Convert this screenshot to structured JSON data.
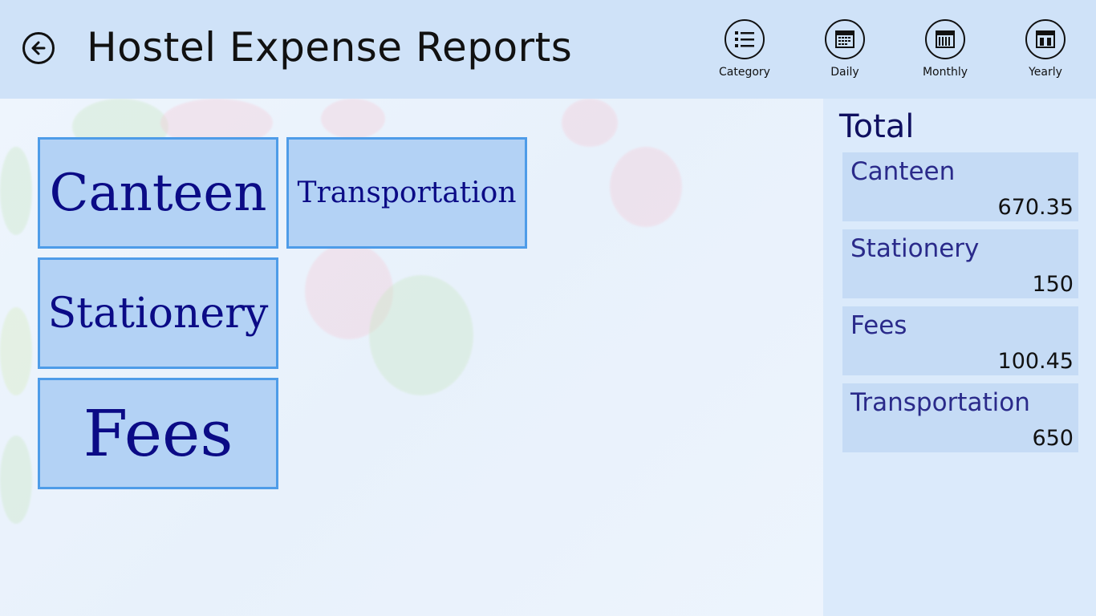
{
  "header": {
    "title": "Hostel Expense Reports",
    "back_icon": "back-arrow-icon"
  },
  "appbar": [
    {
      "label": "Category",
      "icon": "list-icon"
    },
    {
      "label": "Daily",
      "icon": "calendar-day-icon"
    },
    {
      "label": "Monthly",
      "icon": "calendar-month-icon"
    },
    {
      "label": "Yearly",
      "icon": "calendar-year-icon"
    }
  ],
  "tiles": [
    {
      "label": "Canteen"
    },
    {
      "label": "Transportation"
    },
    {
      "label": "Stationery"
    },
    {
      "label": "Fees"
    }
  ],
  "totals": {
    "title": "Total",
    "items": [
      {
        "name": "Canteen",
        "amount": "670.35"
      },
      {
        "name": "Stationery",
        "amount": "150"
      },
      {
        "name": "Fees",
        "amount": "100.45"
      },
      {
        "name": "Transportation",
        "amount": "650"
      }
    ]
  },
  "colors": {
    "header_bg": "#cfe2f8",
    "tile_bg": "#b3d2f5",
    "tile_border": "#4e9ce8",
    "tile_text": "#0b0b86",
    "panel_bg": "#dbeafb"
  }
}
